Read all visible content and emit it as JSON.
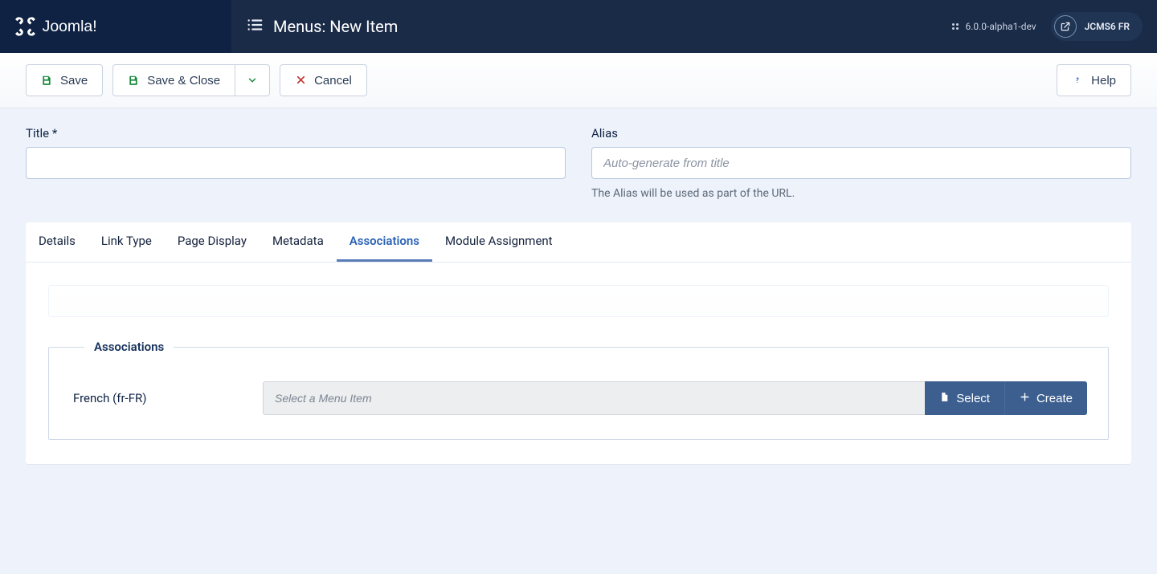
{
  "brand": {
    "name": "Joomla!"
  },
  "header": {
    "title": "Menus: New Item",
    "version": "6.0.0-alpha1-dev",
    "site_badge": "JCMS6 FR"
  },
  "toolbar": {
    "save": "Save",
    "save_close": "Save & Close",
    "cancel": "Cancel",
    "help": "Help"
  },
  "form": {
    "title_label": "Title *",
    "title_value": "",
    "alias_label": "Alias",
    "alias_value": "",
    "alias_placeholder": "Auto-generate from title",
    "alias_hint": "The Alias will be used as part of the URL."
  },
  "tabs": {
    "items": [
      {
        "label": "Details"
      },
      {
        "label": "Link Type"
      },
      {
        "label": "Page Display"
      },
      {
        "label": "Metadata"
      },
      {
        "label": "Associations"
      },
      {
        "label": "Module Assignment"
      }
    ],
    "active_index": 4
  },
  "associations": {
    "legend": "Associations",
    "rows": [
      {
        "language_label": "French (fr-FR)",
        "value": "",
        "placeholder": "Select a Menu Item",
        "select_label": "Select",
        "create_label": "Create"
      }
    ]
  }
}
